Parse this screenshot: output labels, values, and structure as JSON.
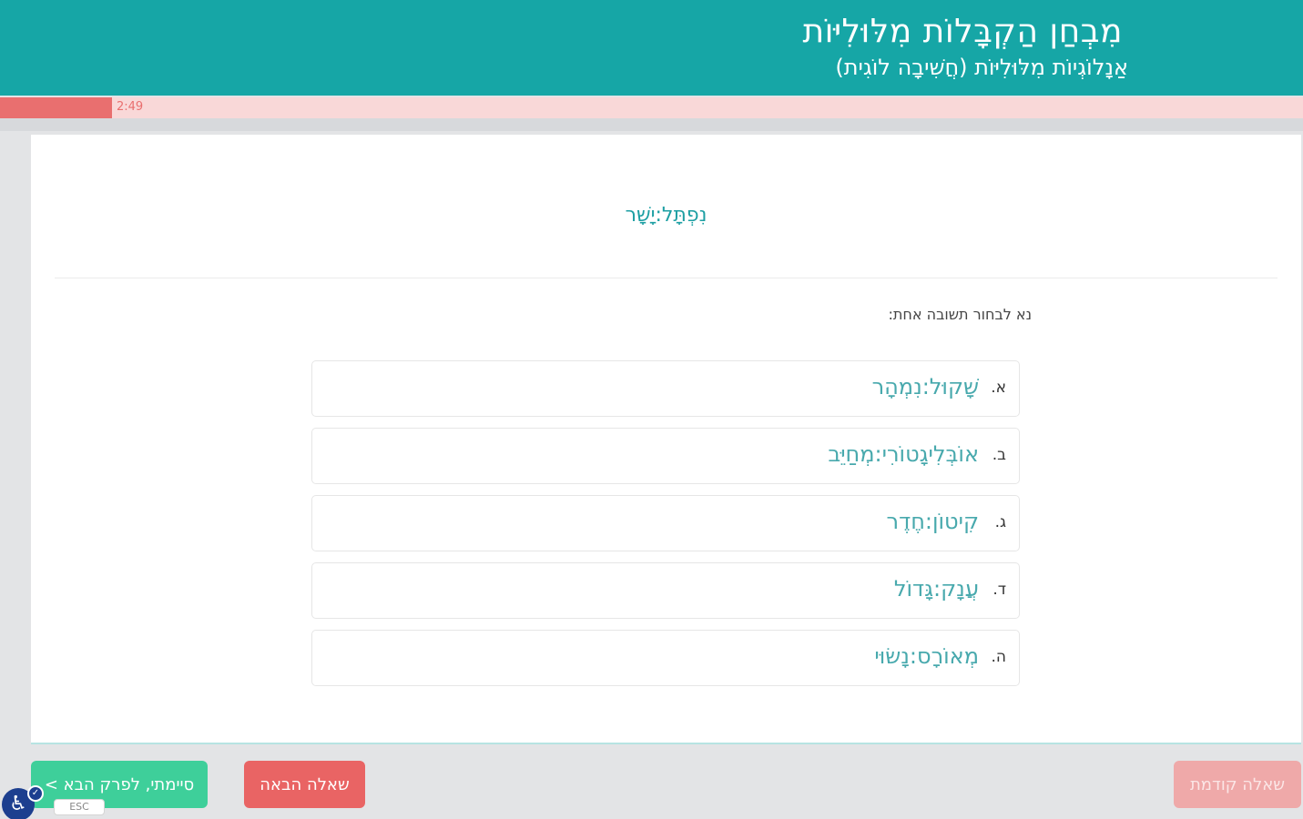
{
  "header": {
    "title": "מִבְחַן הַקְבָּלוֹת מִלּוּלִיּוֹת",
    "subtitle": "אַנָלוֹגְיוֹת מִלּוּלִיּוֹת (חֲשִׁיבָה לוֹגִית)"
  },
  "timer": {
    "text": "2:49",
    "progress_fraction": 0.086,
    "fill_color": "#e96f6f",
    "track_color": "#f9d8d8"
  },
  "question": {
    "prompt": "נִפְתָּל:יָשָׁר",
    "instruction": "נא לבחור תשובה אחת:",
    "options": [
      {
        "letter": "א.",
        "text": "שָׁקוּל:נִמְהָר"
      },
      {
        "letter": "ב.",
        "text": "אוֹבְּלִיגָטוֹרִי:מְחַיֵּב"
      },
      {
        "letter": "ג.",
        "text": "קִיטוֹן:חֶדֶר"
      },
      {
        "letter": "ד.",
        "text": "עֲנָק:גָּדוֹל"
      },
      {
        "letter": "ה.",
        "text": "מְאוֹרָס:נָשׂוּי"
      }
    ]
  },
  "footer": {
    "finish_label": "סיימתי, לפרק הבא >",
    "esc_label": "ESC",
    "next_label": "שאלה הבאה",
    "prev_label": "שאלה קודמת"
  },
  "accessibility": {
    "icon": "accessibility-icon",
    "glyph": "♿",
    "check_glyph": "✓"
  },
  "colors": {
    "header_bg": "#16a6a6",
    "finish_button": "#3ecf9a",
    "next_button": "#e96464",
    "prev_button_disabled": "#efa9a9"
  }
}
